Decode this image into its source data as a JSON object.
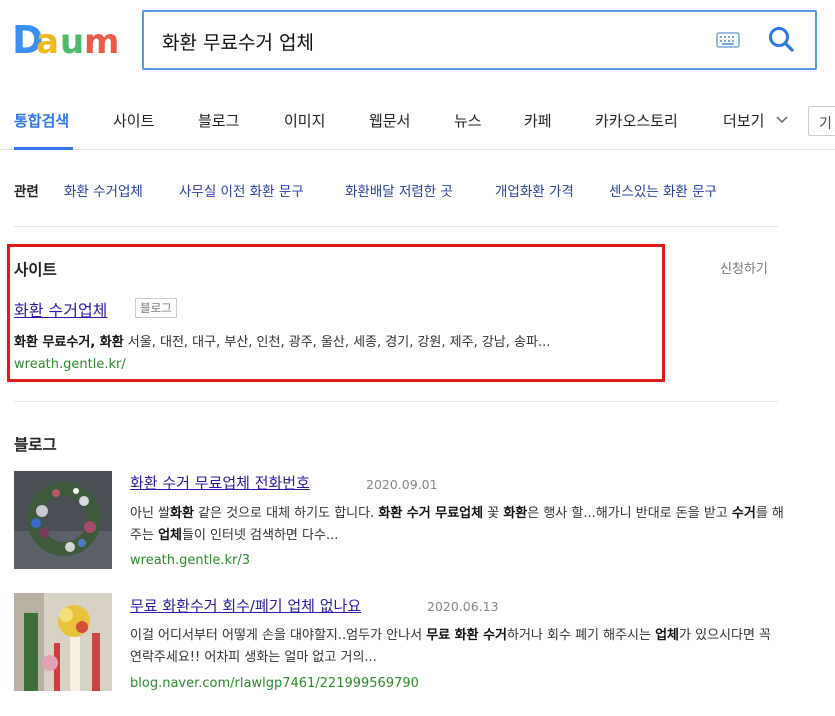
{
  "header": {
    "search_query": "화환 무료수거 업체"
  },
  "tabs": {
    "items": [
      "통합검색",
      "사이트",
      "블로그",
      "이미지",
      "웹문서",
      "뉴스",
      "카페",
      "카카오스토리",
      "더보기"
    ],
    "right_box": "기"
  },
  "related": {
    "label": "관련",
    "items": [
      "화환 수거업체",
      "사무실 이전 화환 문구",
      "화환배달 저렴한 곳",
      "개업화환 가격",
      "센스있는 화환 문구"
    ]
  },
  "site_section": {
    "title": "사이트",
    "apply": "신청하기",
    "result": {
      "title": "화환 수거업체",
      "badge": "블로그",
      "snippet_bold": "화환 무료수거, 화환",
      "snippet_rest": " 서울, 대전, 대구, 부산, 인천, 광주, 울산, 세종, 경기, 강원, 제주, 강남, 송파...",
      "url": "wreath.gentle.kr/"
    }
  },
  "blog_section": {
    "title": "블로그",
    "posts": [
      {
        "title": "화환 수거 무료업체 전화번호",
        "date": "2020.09.01",
        "snippet_html": "아닌 쌀<b>화환</b> 같은 것으로 대체 하기도 합니다. <b>화환 수거 무료업체</b> 꽃 <b>화환</b>은 행사 할...해가니 반대로 돈을 받고 <b>수거</b>를 해 주는 <b>업체</b>들이 인터넷 검색하면 다수...",
        "url": "wreath.gentle.kr/3"
      },
      {
        "title": "무료 화환수거 회수/폐기 업체 없나요",
        "date": "2020.06.13",
        "snippet_html": "이걸 어디서부터 어떻게 손을 대야할지..엄두가 안나서 <b>무료 화환 수거</b>하거나 회수 폐기 해주시는 <b>업체</b>가 있으시다면 꼭 연락주세요!!  어차피 생화는 얼마 없고 거의...",
        "url": "blog.naver.com/rlawlgp7461/221999569790"
      }
    ]
  },
  "colors": {
    "accent_blue": "#3077e8",
    "link_blue": "#2a1ca6",
    "url_green": "#2e8b2e",
    "highlight_red": "#e01b1b"
  }
}
